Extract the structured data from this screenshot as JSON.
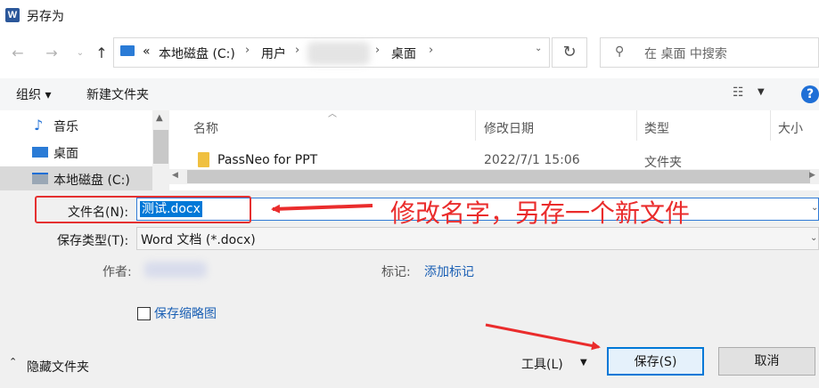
{
  "window": {
    "title": "另存为",
    "app_icon": "W"
  },
  "nav": {
    "breadcrumbs": [
      "«",
      "本地磁盘 (C:)",
      "用户",
      "桌面"
    ],
    "search_placeholder": "在 桌面 中搜索"
  },
  "toolbar": {
    "organize": "组织 ▾",
    "new_folder": "新建文件夹"
  },
  "sidebar": {
    "items": [
      "音乐",
      "桌面",
      "本地磁盘 (C:)"
    ]
  },
  "file_list": {
    "columns": [
      "名称",
      "修改日期",
      "类型",
      "大小"
    ],
    "rows": [
      {
        "name": "PassNeo for PPT",
        "modified": "2022/7/1 15:06",
        "type": "文件夹"
      }
    ]
  },
  "form": {
    "filename_label": "文件名(N):",
    "filename_value": "测试.docx",
    "filetype_label": "保存类型(T):",
    "filetype_value": "Word 文档 (*.docx)",
    "author_label": "作者:",
    "tags_label": "标记:",
    "add_tag": "添加标记",
    "save_thumbnail": "保存缩略图"
  },
  "footer": {
    "hide_folders": "隐藏文件夹",
    "tools": "工具(L)",
    "save": "保存(S)",
    "cancel": "取消"
  },
  "annotation": {
    "text": "修改名字，另存一个新文件",
    "color": "#ea2c2c"
  },
  "colors": {
    "accent": "#0078d7",
    "link": "#1a5fb4"
  }
}
